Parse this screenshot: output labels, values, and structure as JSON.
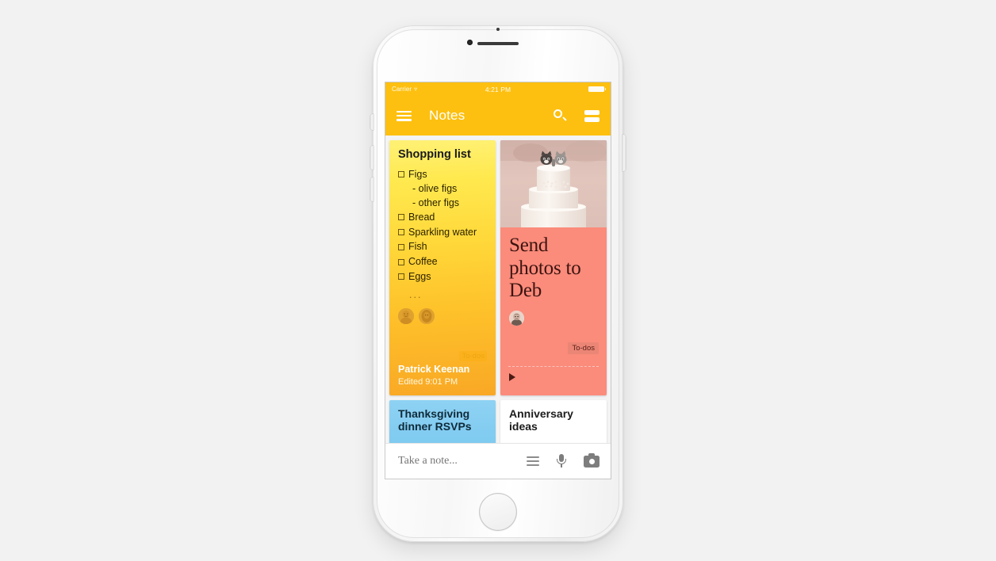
{
  "status_bar": {
    "carrier": "Carrier",
    "wifi_icon": "wifi-icon",
    "time": "4:21 PM",
    "battery_icon": "battery-full-icon"
  },
  "app_bar": {
    "menu_icon": "hamburger-menu-icon",
    "title": "Notes",
    "search_icon": "search-icon",
    "view_toggle_icon": "list-view-toggle-icon",
    "background_color": "#fdc010"
  },
  "notes": {
    "shopping_list": {
      "title": "Shopping list",
      "items": [
        {
          "type": "check",
          "label": "Figs"
        },
        {
          "type": "sub",
          "label": "- olive figs"
        },
        {
          "type": "sub",
          "label": "- other figs"
        },
        {
          "type": "check",
          "label": "Bread"
        },
        {
          "type": "check",
          "label": "Sparkling water"
        },
        {
          "type": "check",
          "label": "Fish"
        },
        {
          "type": "check",
          "label": "Coffee"
        },
        {
          "type": "check",
          "label": "Eggs"
        }
      ],
      "more_indicator": "...",
      "label": "To-dos",
      "author": "Patrick Keenan",
      "edited": "Edited 9:01 PM",
      "collaborator_count": 2,
      "color_top": "#fff176",
      "color_bottom": "#f9a825"
    },
    "send_photos": {
      "title": "Send photos to Deb",
      "image_alt": "wedding-cake-with-cat-toppers",
      "label": "To-dos",
      "collaborator_count": 1,
      "play_icon": "play-triangle-icon",
      "color": "#fb8b7b"
    },
    "thanksgiving": {
      "title": "Thanksgiving dinner RSVPs",
      "color": "#8ed2f3"
    },
    "anniversary": {
      "title": "Anniversary ideas",
      "color": "#ffffff"
    }
  },
  "compose_bar": {
    "placeholder": "Take a note...",
    "list_icon": "checklist-icon",
    "mic_icon": "microphone-icon",
    "camera_icon": "camera-icon"
  },
  "device": {
    "home_button": "home-button",
    "front_camera": "front-camera",
    "earpiece": "earpiece-speaker"
  }
}
